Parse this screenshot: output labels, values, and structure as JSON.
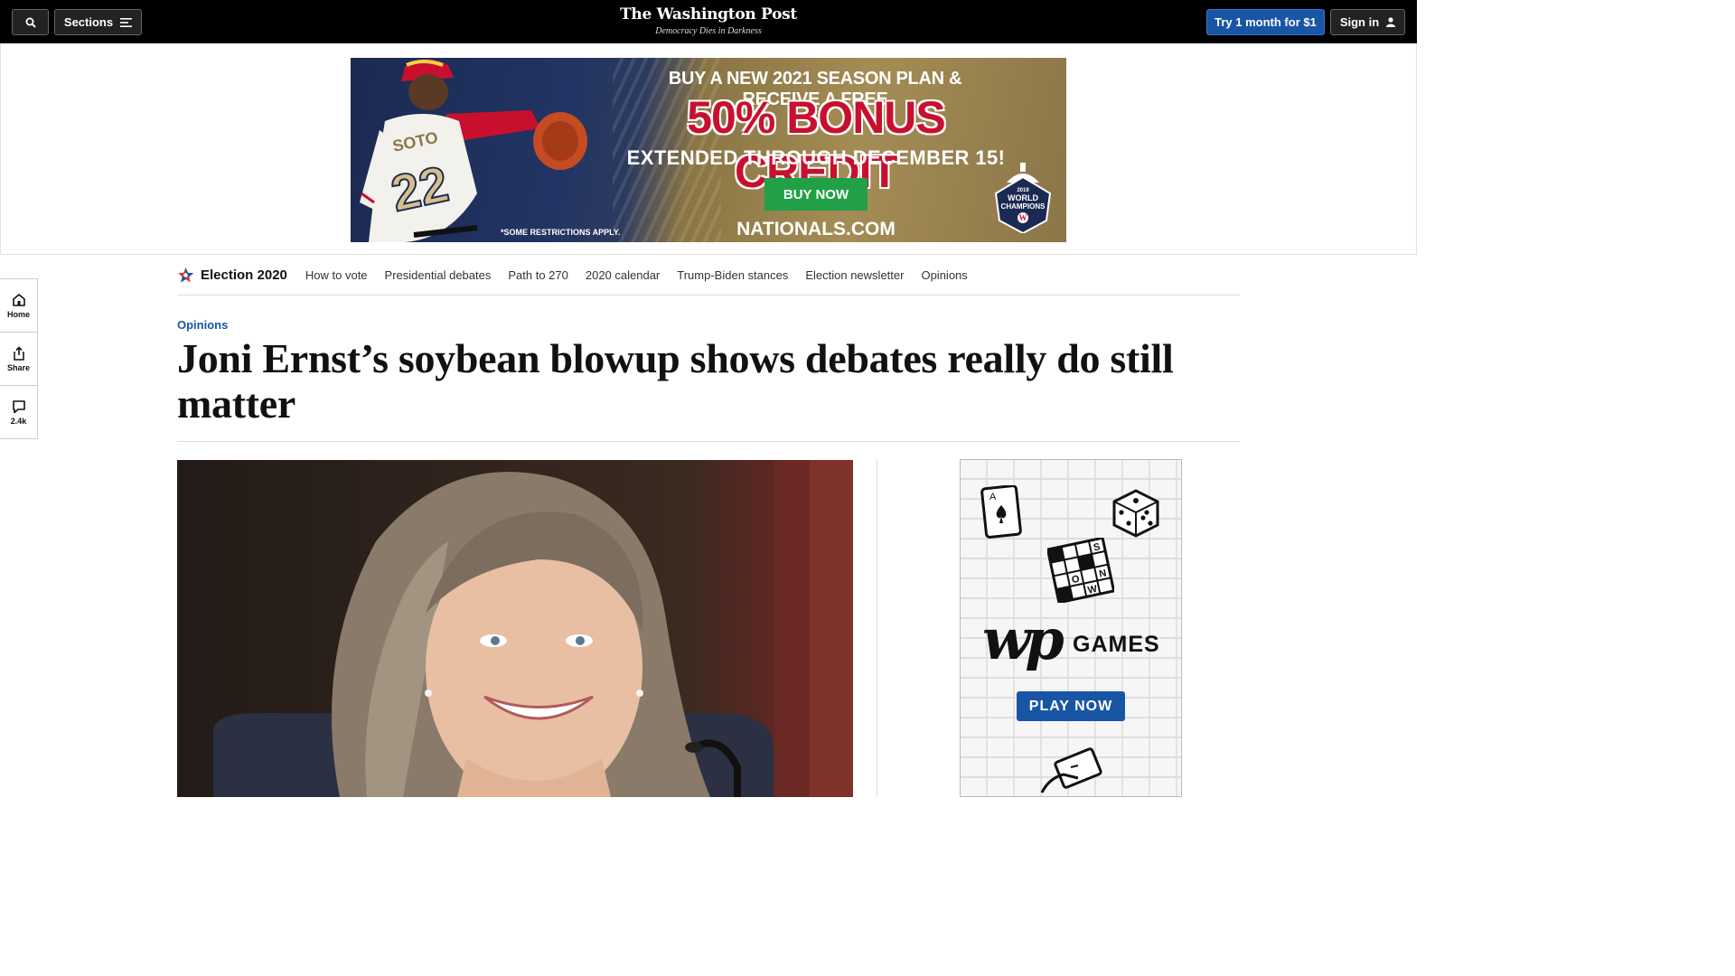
{
  "topbar": {
    "sections_label": "Sections",
    "try_label": "Try 1 month for $1",
    "signin_label": "Sign in",
    "masthead": "The Washington Post",
    "tagline": "Democracy Dies in Darkness"
  },
  "ad": {
    "line1": "BUY A NEW 2021 SEASON PLAN & RECEIVE A FREE",
    "line2": "50% BONUS CREDIT",
    "line3": "EXTENDED THROUGH DECEMBER 15!",
    "buy_label": "BUY NOW",
    "url": "NATIONALS.COM",
    "restrictions": "*SOME RESTRICTIONS APPLY.",
    "jersey_name": "SOTO",
    "jersey_number": "22",
    "badge_year": "2019",
    "badge_line1": "WORLD",
    "badge_line2": "CHAMPIONS"
  },
  "rail": {
    "home_label": "Home",
    "share_label": "Share",
    "comments_count": "2.4k"
  },
  "election_nav": {
    "title": "Election 2020",
    "links": [
      "How to vote",
      "Presidential debates",
      "Path to 270",
      "2020 calendar",
      "Trump-Biden stances",
      "Election newsletter",
      "Opinions"
    ]
  },
  "article": {
    "kicker": "Opinions",
    "headline": "Joni Ernst’s soybean blowup shows debates really do still matter"
  },
  "games_ad": {
    "logo": "wp",
    "games_label": "GAMES",
    "play_label": "PLAY NOW",
    "crossword_letters": [
      "S",
      "O",
      "N",
      "W"
    ]
  }
}
